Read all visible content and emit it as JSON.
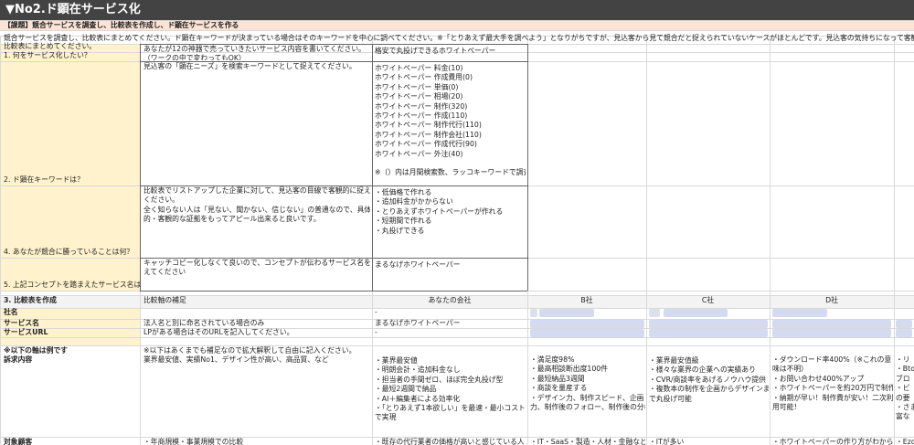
{
  "title_bar": "▼No2.ド顕在サービス化",
  "section_heading": "【課題】競合サービスを調査し、比較表を作成し、ド顕在サービスを作る",
  "intro_text": "競合サービスを調査し、比較表にまとめてください。ド顕在キーワードが決まっている場合はそのキーワードを中心に調べてください。※「とりあえず最大手を調べよう」となりがちですが、見込客から見て競合だと捉えられていないケースがほとんどです。見込客の気持ちになって客観的に探",
  "intro_text_2": "比較表にまとめてください。",
  "colors": {
    "title_bg": "#434343",
    "heading_bg": "#fbe4d5",
    "question_bg": "#fff2cc",
    "header_row_bg": "#f3f3f3",
    "blur_a": "#cdd5ee",
    "blur_b": "#d6dbe8",
    "grid": "#d9d9d9",
    "border": "#666666"
  },
  "questions": [
    {
      "label": "1. 何をサービス化したい？",
      "hint_lines": [
        "あなたが12の神器で売っていきたいサービス内容を書いてください。",
        "（ワークの中で変わってもOK）"
      ],
      "answer_lines": [
        "格安で丸投げできるホワイトペーパー"
      ]
    },
    {
      "label": "2. ド顕在キーワードは？",
      "hint_lines": [
        "見込客の「顕在ニーズ」を検索キーワードとして捉えてください。"
      ],
      "answer_lines": [
        "ホワイトペーパー 料金(10)",
        "ホワイトペーパー 作成費用(0)",
        "ホワイトペーパー 単価(0)",
        "ホワイトペーパー 相場(20)",
        "ホワイトペーパー 制作(320)",
        "ホワイトペーパー 作成(110)",
        "ホワイトペーパー 制作代行(110)",
        "ホワイトペーパー 制作会社(110)",
        "ホワイトペーパー 作成代行(90)",
        "ホワイトペーパー 外注(40)",
        "",
        "※（）内は月間検索数、ラッコキーワードで調査"
      ]
    },
    {
      "label": "4. あなたが競合に勝っていることは何？",
      "hint_lines": [
        "比較表でリストアップした企業に対して、見込客の目線で客観的に捉えて",
        "ください。",
        "全く知らない人は「見ない、聞かない、信じない」の普通なので、具体",
        "的・客観的な証拠をもってアピール出来ると良いです。"
      ],
      "answer_lines": [
        "・低価格で作れる",
        "・追加料金がかからない",
        "・とりあえずホワイトペーパーが作れる",
        "・短期間で作れる",
        "・丸投げできる"
      ]
    },
    {
      "label": "5. 上記コンセプトを踏まえたサービス名は？",
      "hint_lines": [
        "キャッチコピー化しなくて良いので、コンセプトが伝わるサービス名を考",
        "えてください"
      ],
      "answer_lines": [
        "まるなげホワイトペーパー"
      ]
    }
  ],
  "comparison": {
    "section_label": "3. 比較表を作成",
    "axis_label": "比較軸の補足",
    "columns": [
      "あなたの会社",
      "B社",
      "C社",
      "D社"
    ],
    "rows": [
      {
        "label": "社名",
        "hint": "",
        "values": [
          "-",
          "",
          "",
          ""
        ]
      },
      {
        "label": "サービス名",
        "hint": "法人名と別に命名されている場合のみ",
        "values": [
          "まるなげホワイトペーパー",
          "",
          "",
          ""
        ]
      },
      {
        "label": "サービスURL",
        "hint": "LPがある場合はそのURLを記入してください。",
        "values": [
          "-",
          "",
          "",
          ""
        ]
      }
    ],
    "note_row": {
      "label": "※以下の軸は例です",
      "hint": "※以下はあくまでも補足なので拡大解釈して自由に記入ください。"
    },
    "appeal_row": {
      "label": "訴求内容",
      "hint": "業界最安値、実績No1、デザイン性が高い、高品質、など",
      "values": [
        [
          "・業界最安値",
          "・明朗会計・追加料金なし",
          "・担当者の手間ゼロ、ほぼ完全丸投げ型",
          "・最短2週間で納品",
          "・AI＋編集者による効率化",
          "・「とりあえず1本欲しい」を最速・最小コスト",
          "で実現"
        ],
        [
          "・満足度98%",
          "・最高相談断出度100件",
          "・最短納品3週間",
          "・商談を量産する",
          "・デザイン力、制作スピード、企画",
          "力、制作後のフォロー、制作後の分析"
        ],
        [
          "・業界最安值級",
          "・様々な業界の企業への実績あり",
          "・CVR/商談率をあげるノウハウ提供",
          "・複数本の制作を企画からデザインま",
          "で丸投げ可能"
        ],
        [
          "・ダウンロード率400%（※これの意",
          "味は不明）",
          "・お問い合わせ400%アップ",
          "・ホワイトペーパーを約20万円で制作",
          "・納期が早い！制作費が安い！二次利",
          "用可能！"
        ]
      ],
      "extra_col": [
        "・リ",
        "・Bto",
        "ブロ",
        "・ビ",
        "の要",
        "・さま",
        "富な"
      ]
    },
    "target_row": {
      "label": "対象顧客",
      "hint": "・年商規模・事業規模での比較",
      "values": [
        "・既存の代行業者の価格が高いと感じている人",
        "・IT・SaaS・製造・人材・金融など",
        "・ITが多い",
        "・ホワイトペーパーの作り方がわから"
      ],
      "extra": "・Ezo"
    }
  }
}
